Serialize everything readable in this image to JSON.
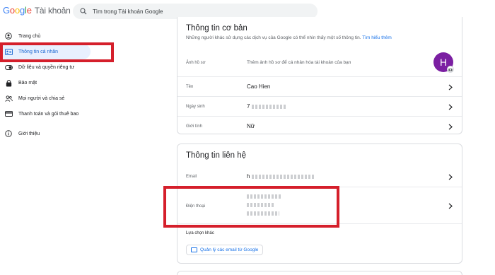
{
  "header": {
    "logo_letters": [
      "G",
      "o",
      "o",
      "g",
      "l",
      "e"
    ],
    "product_name": "Tài khoản",
    "search_placeholder": "Tìm trong Tài khoản Google"
  },
  "sidebar": {
    "items": [
      {
        "label": "Trang chủ",
        "icon": "person-circle-icon"
      },
      {
        "label": "Thông tin cá nhân",
        "icon": "id-card-icon",
        "active": true
      },
      {
        "label": "Dữ liệu và quyền riêng tư",
        "icon": "toggle-icon"
      },
      {
        "label": "Bảo mật",
        "icon": "lock-icon"
      },
      {
        "label": "Mọi người và chia sẻ",
        "icon": "people-icon"
      },
      {
        "label": "Thanh toán và gói thuê bao",
        "icon": "credit-card-icon"
      },
      {
        "label": "Giới thiệu",
        "icon": "info-icon"
      }
    ]
  },
  "basic_info": {
    "title": "Thông tin cơ bản",
    "subtitle": "Những người khác sử dụng các dịch vụ của Google có thể nhìn thấy một số thông tin.",
    "learn_more": "Tìm hiểu thêm",
    "photo_label": "Ảnh hồ sơ",
    "photo_desc": "Thêm ảnh hồ sơ để cá nhân hóa tài khoản của bạn",
    "avatar_initial": "H",
    "name_label": "Tên",
    "name_value": "Cao Hien",
    "birthday_label": "Ngày sinh",
    "birthday_value": "7",
    "gender_label": "Giới tính",
    "gender_value": "Nữ"
  },
  "contact_info": {
    "title": "Thông tin liên hệ",
    "email_label": "Email",
    "email_value": "h",
    "phone_label": "Điện thoại",
    "other_label": "Lựa chọn khác",
    "manage_email_button": "Quản lý các email từ Google"
  },
  "colors": {
    "accent": "#1a73e8",
    "active_bg": "#e8f0fe",
    "highlight": "#d51f2b",
    "avatar": "#7b1fa2"
  }
}
